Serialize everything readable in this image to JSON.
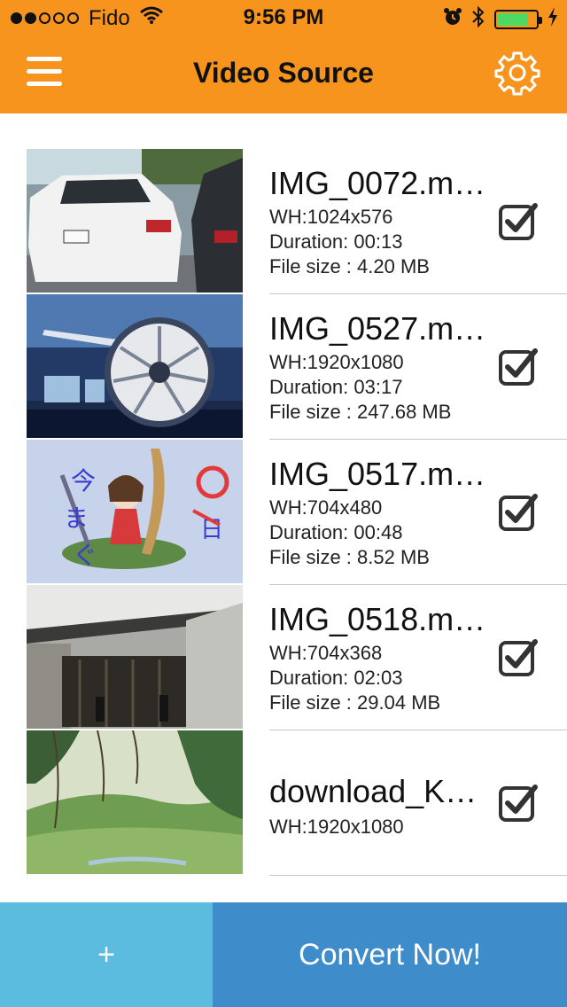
{
  "status_bar": {
    "carrier": "Fido",
    "time": "9:56 PM",
    "signal_bars_filled": 2,
    "signal_bars_total": 5,
    "battery_level": 0.8
  },
  "header": {
    "title": "Video Source",
    "background_color": "#F7941E",
    "menu_icon": "hamburger-menu-icon",
    "settings_icon": "gear-icon"
  },
  "videos": [
    {
      "name": "IMG_0072.m…",
      "resolution": "WH:1024x576",
      "duration": "Duration: 00:13",
      "file_size": "File size : 4.20 MB",
      "checked": true
    },
    {
      "name": "IMG_0527.m…",
      "resolution": "WH:1920x1080",
      "duration": "Duration: 03:17",
      "file_size": "File size : 247.68 MB",
      "checked": true
    },
    {
      "name": "IMG_0517.m…",
      "resolution": "WH:704x480",
      "duration": "Duration: 00:48",
      "file_size": "File size : 8.52 MB",
      "checked": true
    },
    {
      "name": "IMG_0518.m…",
      "resolution": "WH:704x368",
      "duration": "Duration: 02:03",
      "file_size": "File size : 29.04 MB",
      "checked": true
    },
    {
      "name": "download_K…",
      "resolution": "WH:1920x1080",
      "checked": true
    }
  ],
  "footer": {
    "add_label": "+",
    "convert_label": "Convert Now!",
    "add_color": "#5BBCE0",
    "convert_color": "#3F8CCB"
  }
}
